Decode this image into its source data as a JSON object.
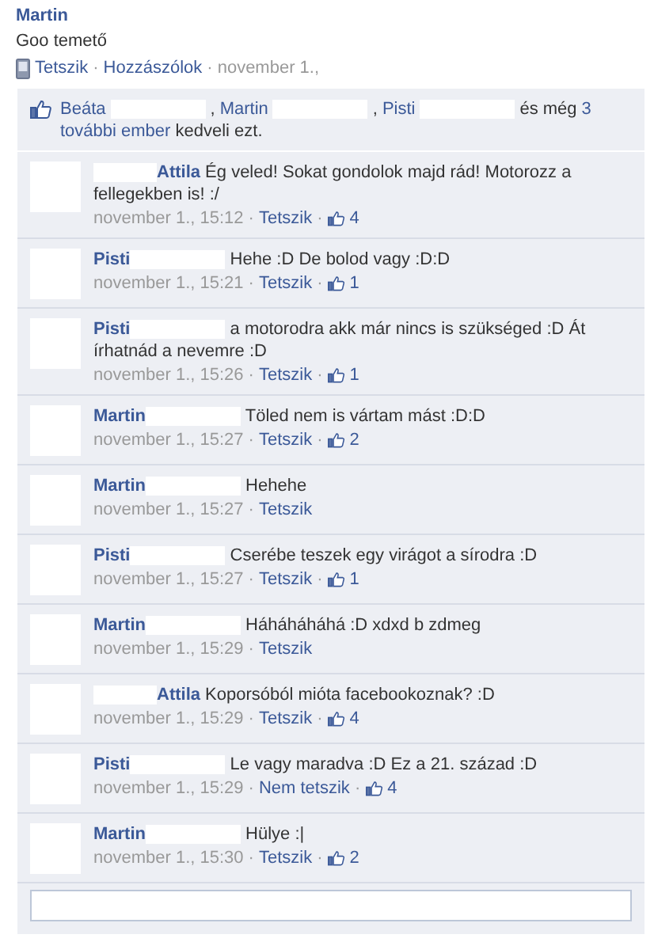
{
  "post": {
    "author": "Martin",
    "text": "Goo temető",
    "actions": [
      {
        "label": "Tetszik",
        "kind": "link"
      },
      {
        "sep_before": "·",
        "label": "Hozzászólok",
        "kind": "link"
      },
      {
        "sep_before": "·",
        "label": "november 1.,",
        "kind": "time"
      }
    ]
  },
  "likes": {
    "people": [
      {
        "name": "Beáta",
        "comma": ","
      },
      {
        "name": "Martin",
        "comma": ","
      },
      {
        "name": "Pisti"
      }
    ],
    "and_more": "és még",
    "more_count": "3",
    "more_people": "további ember",
    "suffix": "kedveli ezt."
  },
  "comments": [
    {
      "author": "Attila",
      "kind": "prefixed",
      "text": "Ég veled! Sokat gondolok majd rád! Motorozz a fellegekben is! :/",
      "time": "november 1., 15:12",
      "separators": [
        "·",
        "·"
      ],
      "like_label": "Tetszik",
      "like_count": "4"
    },
    {
      "author": "Pisti",
      "kind": "suffixed",
      "text": "Hehe :D De bolod vagy :D:D",
      "time": "november 1., 15:21",
      "separators": [
        "·",
        "·"
      ],
      "like_label": "Tetszik",
      "like_count": "1"
    },
    {
      "author": "Pisti",
      "kind": "suffixed",
      "text": "a motorodra akk már nincs is szükséged :D Át írhatnád a nevemre :D",
      "time": "november 1., 15:26",
      "separators": [
        "·",
        "·"
      ],
      "like_label": "Tetszik",
      "like_count": "1"
    },
    {
      "author": "Martin",
      "kind": "suffixed",
      "text": "Töled nem is vártam mást :D:D",
      "time": "november 1., 15:27",
      "separators": [
        "·",
        "·"
      ],
      "like_label": "Tetszik",
      "like_count": "2"
    },
    {
      "author": "Martin",
      "kind": "suffixed",
      "text": "Hehehe",
      "time": "november 1., 15:27",
      "separators": [
        "·"
      ],
      "like_label": "Tetszik"
    },
    {
      "author": "Pisti",
      "kind": "suffixed",
      "text": "Cserébe teszek egy virágot a sírodra :D",
      "time": "november 1., 15:27",
      "separators": [
        "·",
        "·"
      ],
      "like_label": "Tetszik",
      "like_count": "1"
    },
    {
      "author": "Martin",
      "kind": "suffixed",
      "text": "Háháháháhá :D xdxd b   zdmeg",
      "time": "november 1., 15:29",
      "separators": [
        "·"
      ],
      "like_label": "Tetszik"
    },
    {
      "author": "Attila",
      "kind": "prefixed",
      "text": "Koporsóból mióta facebookoznak? :D",
      "time": "november 1., 15:29",
      "separators": [
        "·",
        "·"
      ],
      "like_label": "Tetszik",
      "like_count": "4"
    },
    {
      "author": "Pisti",
      "kind": "suffixed",
      "text": "Le vagy maradva :D Ez a 21. század :D",
      "time": "november 1., 15:29",
      "separators": [
        "·",
        "·"
      ],
      "like_label": "Nem tetszik",
      "like_count": "4"
    },
    {
      "author": "Martin",
      "kind": "suffixed",
      "text": "Hülye :|",
      "time": "november 1., 15:30",
      "separators": [
        "·",
        "·"
      ],
      "like_label": "Tetszik",
      "like_count": "2"
    }
  ]
}
